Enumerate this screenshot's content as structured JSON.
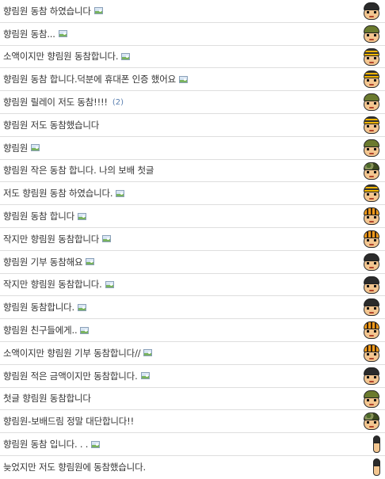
{
  "posts": [
    {
      "title": "향림원 동참 하였습니다",
      "has_image": true,
      "comments": "",
      "avatar": "helmet-black"
    },
    {
      "title": "향림원 동참...",
      "has_image": true,
      "comments": "",
      "avatar": "helmet-olive"
    },
    {
      "title": "소액이지만 향림원 동참합니다.",
      "has_image": true,
      "comments": "",
      "avatar": "helmet-yellow"
    },
    {
      "title": "향림원 동참 합니다.덕분에 휴대폰 인증 했어요",
      "has_image": true,
      "comments": "",
      "avatar": "helmet-yellow"
    },
    {
      "title": "향림원 릴레이 저도 동참!!!!",
      "has_image": false,
      "comments": "(2)",
      "avatar": "helmet-olive"
    },
    {
      "title": "향림원 저도 동참했습니다",
      "has_image": false,
      "comments": "",
      "avatar": "helmet-yellow"
    },
    {
      "title": "향림원",
      "has_image": true,
      "comments": "",
      "avatar": "helmet-olive"
    },
    {
      "title": "향림원 작은 동참 합니다. 나의 보배 첫글",
      "has_image": false,
      "comments": "",
      "avatar": "helmet-camo"
    },
    {
      "title": "저도 향림원 동참 하였습니다.",
      "has_image": true,
      "comments": "",
      "avatar": "helmet-yellow"
    },
    {
      "title": "향림원 동참 합니다",
      "has_image": true,
      "comments": "",
      "avatar": "helmet-tiger"
    },
    {
      "title": "작지만 향림원 동참합니다",
      "has_image": true,
      "comments": "",
      "avatar": "helmet-tiger"
    },
    {
      "title": "향림원 기부 동참해요",
      "has_image": true,
      "comments": "",
      "avatar": "helmet-black"
    },
    {
      "title": "작지만 향림원 동참합니다.",
      "has_image": true,
      "comments": "",
      "avatar": "helmet-black"
    },
    {
      "title": "향림원 동참합니다.",
      "has_image": true,
      "comments": "",
      "avatar": "helmet-black"
    },
    {
      "title": "향림원 친구들에게..",
      "has_image": true,
      "comments": "",
      "avatar": "helmet-tiger"
    },
    {
      "title": "소액이지만 향림원 기부 동참합니다//",
      "has_image": true,
      "comments": "",
      "avatar": "helmet-tiger"
    },
    {
      "title": "향림원 적은 금액이지만 동참합니다.",
      "has_image": true,
      "comments": "",
      "avatar": "helmet-black"
    },
    {
      "title": "첫글 향림원 동참합니다",
      "has_image": false,
      "comments": "",
      "avatar": "helmet-olive"
    },
    {
      "title": "향림원-보배드림 정말 대단합니다!!",
      "has_image": false,
      "comments": "",
      "avatar": "helmet-camo"
    },
    {
      "title": "향림원 동참 입니다. . .",
      "has_image": true,
      "comments": "",
      "avatar": "partial"
    },
    {
      "title": "늦었지만 저도 향림원에 동참했습니다.",
      "has_image": false,
      "comments": "",
      "avatar": "partial"
    }
  ],
  "colors": {
    "text": "#333333",
    "divider": "#dedede",
    "comment_count": "#5a7fb0"
  }
}
